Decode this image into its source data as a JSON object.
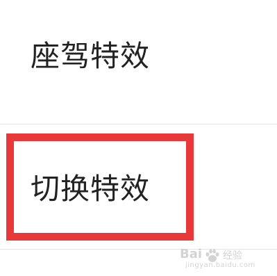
{
  "settings": {
    "items": [
      {
        "label": "座驾特效"
      },
      {
        "label": "切换特效"
      }
    ]
  },
  "highlight": {
    "color": "#e8383a"
  },
  "watermark": {
    "logo": "Bai",
    "cn": "经验",
    "site": "jingyan.baidu.com"
  }
}
